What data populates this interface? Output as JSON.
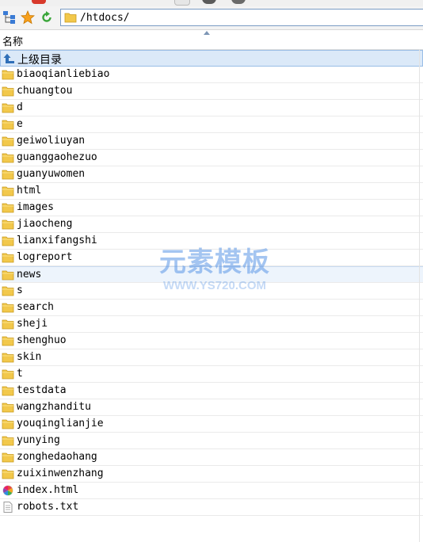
{
  "toolbar": {
    "path_value": "/htdocs/"
  },
  "header": {
    "name_column": "名称"
  },
  "parent_row": {
    "label": "上级目录",
    "icon": "up-arrow-icon"
  },
  "entries": [
    {
      "name": "biaoqianliebiao",
      "type": "folder"
    },
    {
      "name": "chuangtou",
      "type": "folder"
    },
    {
      "name": "d",
      "type": "folder"
    },
    {
      "name": "e",
      "type": "folder"
    },
    {
      "name": "geiwoliuyan",
      "type": "folder"
    },
    {
      "name": "guanggaohezuo",
      "type": "folder"
    },
    {
      "name": "guanyuwomen",
      "type": "folder"
    },
    {
      "name": "html",
      "type": "folder"
    },
    {
      "name": "images",
      "type": "folder"
    },
    {
      "name": "jiaocheng",
      "type": "folder"
    },
    {
      "name": "lianxifangshi",
      "type": "folder"
    },
    {
      "name": "logreport",
      "type": "folder"
    },
    {
      "name": "news",
      "type": "folder",
      "highlighted": true
    },
    {
      "name": "s",
      "type": "folder"
    },
    {
      "name": "search",
      "type": "folder"
    },
    {
      "name": "sheji",
      "type": "folder"
    },
    {
      "name": "shenghuo",
      "type": "folder"
    },
    {
      "name": "skin",
      "type": "folder"
    },
    {
      "name": "t",
      "type": "folder"
    },
    {
      "name": "testdata",
      "type": "folder"
    },
    {
      "name": "wangzhanditu",
      "type": "folder"
    },
    {
      "name": "youqinglianjie",
      "type": "folder"
    },
    {
      "name": "yunying",
      "type": "folder"
    },
    {
      "name": "zonghedaohang",
      "type": "folder"
    },
    {
      "name": "zuixinwenzhang",
      "type": "folder"
    },
    {
      "name": "index.html",
      "type": "html-file"
    },
    {
      "name": "robots.txt",
      "type": "text-file"
    }
  ],
  "watermark": {
    "title": "元素模板",
    "url": "WWW.YS720.COM"
  },
  "colors": {
    "selection_bg": "#dbe9f8",
    "highlight_bg": "#edf4fc",
    "folder": "#f2c84b",
    "watermark": "#5a96e6"
  }
}
